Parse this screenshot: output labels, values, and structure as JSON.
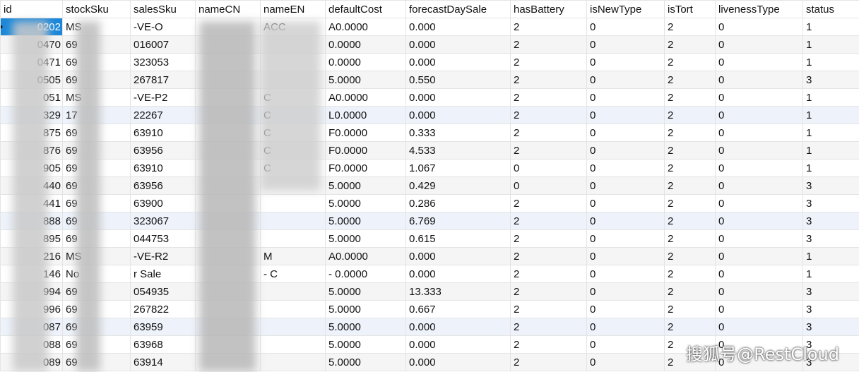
{
  "columns": [
    "id",
    "stockSku",
    "salesSku",
    "nameCN",
    "nameEN",
    "defaultCost",
    "forecastDaySale",
    "hasBattery",
    "isNewType",
    "isTort",
    "livenessType",
    "status"
  ],
  "rows": [
    [
      "0202",
      "MS",
      "-VE-O",
      "",
      "ACC",
      "A0.0000",
      "0.000",
      "2",
      "0",
      "2",
      "0",
      "1"
    ],
    [
      "0470",
      "69",
      "016007",
      "",
      "",
      "0.0000",
      "0.000",
      "2",
      "0",
      "2",
      "0",
      "1"
    ],
    [
      "0471",
      "69",
      "323053",
      "",
      "",
      "0.0000",
      "0.000",
      "2",
      "0",
      "2",
      "0",
      "1"
    ],
    [
      "0505",
      "69",
      "267817",
      "",
      "",
      "5.0000",
      "0.550",
      "2",
      "0",
      "2",
      "0",
      "3"
    ],
    [
      "051",
      "MS",
      "-VE-P2",
      "",
      "C",
      "A0.0000",
      "0.000",
      "2",
      "0",
      "2",
      "0",
      "1"
    ],
    [
      "329",
      "17",
      "22267",
      "",
      "C",
      "L0.0000",
      "0.000",
      "2",
      "0",
      "2",
      "0",
      "1"
    ],
    [
      "875",
      "69",
      "63910",
      "",
      "C",
      "F0.0000",
      "0.333",
      "2",
      "0",
      "2",
      "0",
      "1"
    ],
    [
      "876",
      "69",
      "63956",
      "",
      "C",
      "F0.0000",
      "4.533",
      "2",
      "0",
      "2",
      "0",
      "1"
    ],
    [
      "905",
      "69",
      "63910",
      "",
      "C",
      "F0.0000",
      "1.067",
      "0",
      "0",
      "2",
      "0",
      "1"
    ],
    [
      "440",
      "69",
      "63956",
      "",
      "",
      "5.0000",
      "0.429",
      "0",
      "0",
      "2",
      "0",
      "3"
    ],
    [
      "441",
      "69",
      "63900",
      "",
      "",
      "5.0000",
      "0.286",
      "2",
      "0",
      "2",
      "0",
      "3"
    ],
    [
      "888",
      "69",
      "323067",
      "",
      "",
      "5.0000",
      "6.769",
      "2",
      "0",
      "2",
      "0",
      "3"
    ],
    [
      "895",
      "69",
      "044753",
      "",
      "",
      "5.0000",
      "0.615",
      "2",
      "0",
      "2",
      "0",
      "3"
    ],
    [
      "216",
      "MS",
      "-VE-R2",
      "",
      "M",
      "A0.0000",
      "0.000",
      "2",
      "0",
      "2",
      "0",
      "1"
    ],
    [
      "146",
      "No",
      "r Sale",
      "",
      "- C",
      "- 0.0000",
      "0.000",
      "2",
      "0",
      "2",
      "0",
      "1"
    ],
    [
      "994",
      "69",
      "054935",
      "",
      "",
      "5.0000",
      "13.333",
      "2",
      "0",
      "2",
      "0",
      "3"
    ],
    [
      "996",
      "69",
      "267822",
      "",
      "",
      "5.0000",
      "0.667",
      "2",
      "0",
      "2",
      "0",
      "3"
    ],
    [
      "087",
      "69",
      "63959",
      "",
      "",
      "5.0000",
      "0.000",
      "2",
      "0",
      "2",
      "0",
      "3"
    ],
    [
      "088",
      "69",
      "63968",
      "",
      "",
      "5.0000",
      "0.000",
      "2",
      "0",
      "2",
      "0",
      "3"
    ],
    [
      "089",
      "69",
      "63914",
      "",
      "",
      "5.0000",
      "0.000",
      "2",
      "0",
      "2",
      "0",
      "3"
    ]
  ],
  "watermark": "搜狐号@RestCloud"
}
